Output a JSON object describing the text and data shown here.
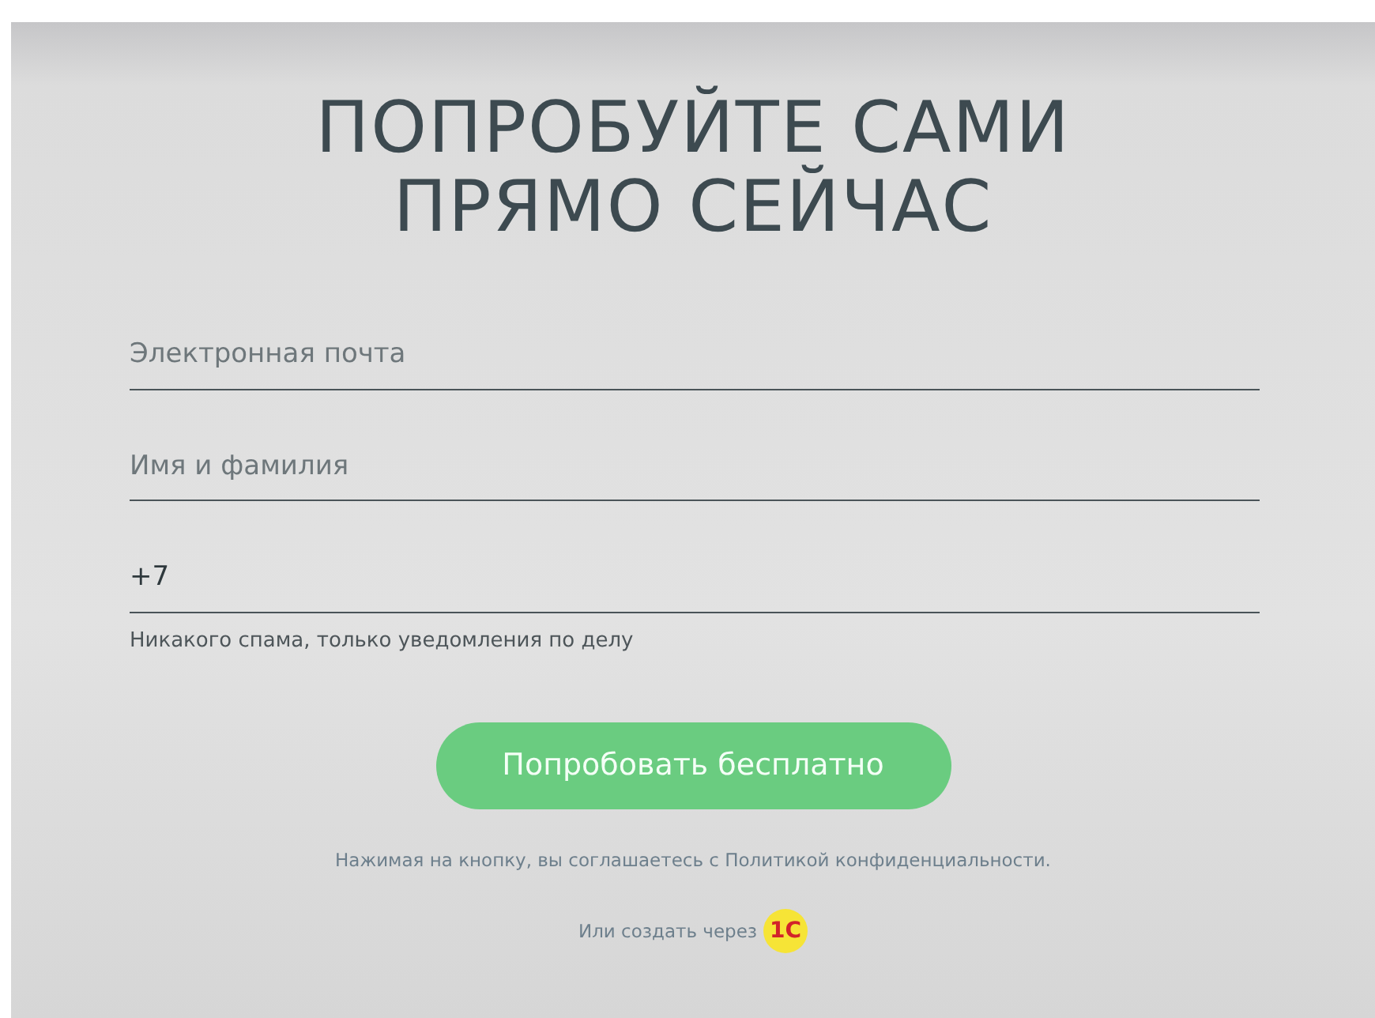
{
  "title_lines": [
    "ПОПРОБУЙТЕ САМИ",
    "ПРЯМО СЕЙЧАС"
  ],
  "fields": [
    {
      "placeholder": "Электронная почта"
    },
    {
      "placeholder": "Имя и фамилия"
    },
    {
      "value": "+7",
      "hint": "Никакого спама, только уведомления по делу"
    }
  ],
  "submit_button": "Попробовать бесплатно",
  "consent_text": "Нажимая на кнопку, вы соглашаетесь с Политикой конфиденциальности.",
  "alt_signup": {
    "label": "Или создать через",
    "logo_text": "1С"
  }
}
